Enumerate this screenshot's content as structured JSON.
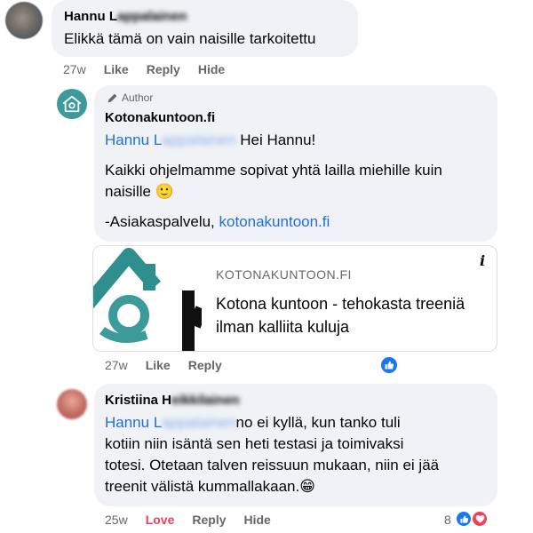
{
  "comment1": {
    "author_visible": "Hannu L",
    "author_blurred": "appalainen",
    "text": "Elikkä tämä on vain naisille tarkoitettu",
    "time": "27w",
    "like": "Like",
    "reply": "Reply",
    "hide": "Hide"
  },
  "reply1": {
    "badge": "Author",
    "author": "Kotonakuntoon.fi",
    "mention_visible": "Hannu L",
    "mention_blurred": "appalainen",
    "greeting": "Hei Hannu!",
    "line1": "Kaikki ohjelmamme sopivat yhtä lailla miehille kuin",
    "line2": "naisille",
    "emoji": "🙂",
    "signoff_prefix": "-Asiakaspalvelu, ",
    "signoff_link": "kotonakuntoon.fi",
    "time": "27w",
    "like": "Like",
    "reply": "Reply",
    "link_card": {
      "domain": "KOTONAKUNTOON.FI",
      "title": "Kotona kuntoon - tehokasta treeniä ilman kalliita kuluja",
      "info": "i"
    }
  },
  "comment2": {
    "author_visible": "Kristiina H",
    "author_blurred": "eikkilainen",
    "mention_visible": "Hannu L",
    "mention_blurred": "appalainen",
    "line1": "no ei kyllä, kun tanko tuli",
    "line2": "kotiin niin isäntä sen heti testasi ja toimivaksi",
    "line3": "totesi. Otetaan talven reissuun mukaan, niin ei jää",
    "line4": "treenit välistä kummallakaan.",
    "emoji": "😁",
    "time": "25w",
    "love": "Love",
    "reply": "Reply",
    "hide": "Hide",
    "reaction_count": "8"
  },
  "colors": {
    "accent": "#216fdb",
    "bubble": "#f0f2f5",
    "like": "#1877f2",
    "love": "#f33e58",
    "muted": "#65676b",
    "brand_teal": "#3d9a9b"
  }
}
